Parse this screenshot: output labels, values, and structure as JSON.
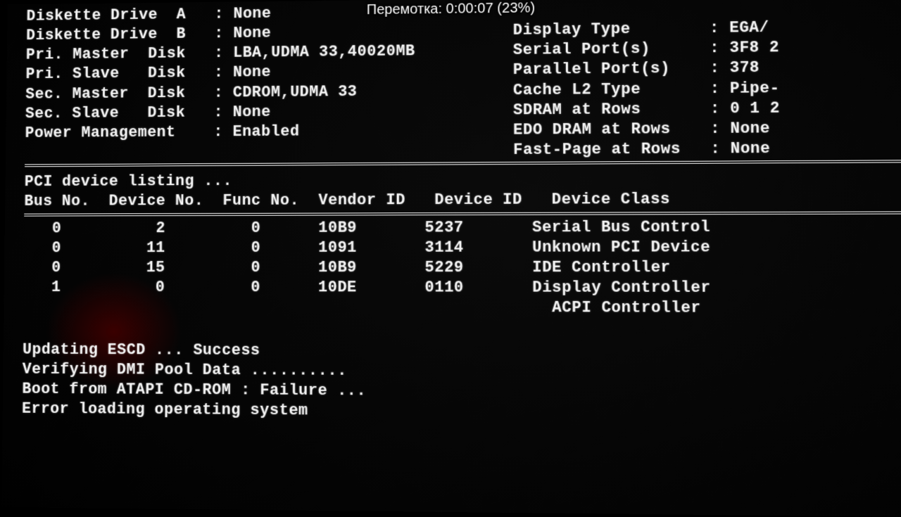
{
  "overlay_text": "Перемотка: 0:00:07 (23%)",
  "summary": {
    "left": [
      {
        "label": "Diskette Drive  A",
        "value": "None"
      },
      {
        "label": "Diskette Drive  B",
        "value": "None"
      },
      {
        "label": "Pri. Master  Disk",
        "value": "LBA,UDMA 33,40020MB"
      },
      {
        "label": "Pri. Slave   Disk",
        "value": "None"
      },
      {
        "label": "Sec. Master  Disk",
        "value": "CDROM,UDMA 33"
      },
      {
        "label": "Sec. Slave   Disk",
        "value": "None"
      },
      {
        "label": "Power Management ",
        "value": "Enabled"
      }
    ],
    "right": [
      {
        "label": "Display Type",
        "value": "EGA/"
      },
      {
        "label": "Serial Port(s)",
        "value": "3F8 2"
      },
      {
        "label": "Parallel Port(s)",
        "value": "378"
      },
      {
        "label": "Cache L2 Type",
        "value": "Pipe-"
      },
      {
        "label": "SDRAM at Rows",
        "value": "0 1 2"
      },
      {
        "label": "EDO DRAM at Rows",
        "value": "None"
      },
      {
        "label": "Fast-Page at Rows",
        "value": "None"
      }
    ]
  },
  "pci": {
    "heading": "PCI device listing ...",
    "columns": [
      "Bus No.",
      "Device No.",
      "Func No.",
      "Vendor ID",
      "Device ID",
      "Device Class"
    ],
    "rows": [
      {
        "bus": "0",
        "dev": "2",
        "func": "0",
        "vid": "10B9",
        "did": "5237",
        "class": "Serial Bus Control"
      },
      {
        "bus": "0",
        "dev": "11",
        "func": "0",
        "vid": "1091",
        "did": "3114",
        "class": "Unknown PCI Device"
      },
      {
        "bus": "0",
        "dev": "15",
        "func": "0",
        "vid": "10B9",
        "did": "5229",
        "class": "IDE Controller"
      },
      {
        "bus": "1",
        "dev": "0",
        "func": "0",
        "vid": "10DE",
        "did": "0110",
        "class": "Display Controller"
      }
    ],
    "extra_class": "ACPI Controller"
  },
  "status": [
    "Updating ESCD ... Success",
    "Verifying DMI Pool Data ..........",
    "Boot from ATAPI CD-ROM :  Failure ...",
    "Error loading operating system"
  ]
}
